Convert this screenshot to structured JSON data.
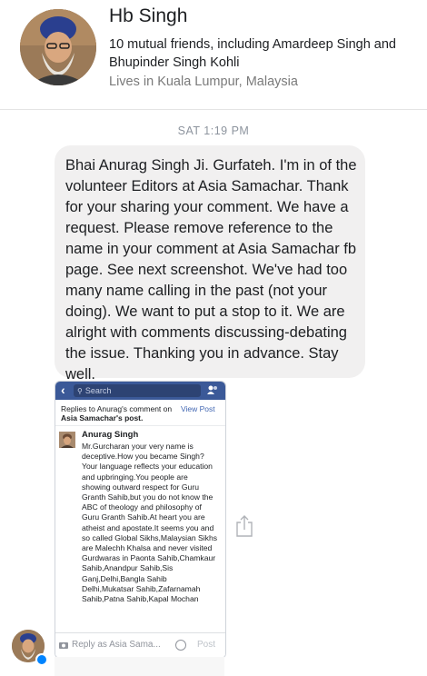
{
  "profile": {
    "name": "Hb Singh",
    "mutual_friends": "10 mutual friends, including Amardeep Singh and Bhupinder Singh Kohli",
    "lives_in": "Lives in Kuala Lumpur, Malaysia"
  },
  "timestamp": "SAT 1:19 PM",
  "message": {
    "text": "Bhai Anurag Singh Ji. Gurfateh. I'm in of the volunteer Editors at Asia Samachar. Thank for your sharing your comment. We have a request. Please remove reference to the name in your comment at Asia Samachar fb page. See next screenshot. We've had too many name calling in the past (not your doing). We want to put a stop to it. We are alright with comments discussing-debating the issue. Thanking you in advance. Stay well."
  },
  "screenshot": {
    "search_placeholder": "Search",
    "replies_prefix": "Replies to Anurag's comment on",
    "replies_page": "Asia Samachar's post.",
    "view_post": "View Post",
    "commenter": "Anurag Singh",
    "comment": "Mr.Gurcharan your very name is deceptive.How you became Singh? Your language reflects your education and upbringing.You people are showing outward respect for Guru Granth Sahib,but you do not know the ABC of theology and philosophy of Guru Granth Sahib.At heart you are atheist and apostate.It seems you and so called Global Sikhs,Malaysian Sikhs are Malechh Khalsa and never visited Gurdwaras in Paonta Sahib,Chamkaur Sahib,Anandpur Sahib,Sis Ganj,Delhi,Bangla Sahib Delhi,Mukatsar Sahib,Zafarnamah Sahib,Patna Sahib,Kapal Mochan",
    "reply_placeholder": "Reply as Asia Sama...",
    "post_label": "Post"
  },
  "colors": {
    "facebook_blue": "#3b5998",
    "link_blue": "#4267b2",
    "messenger_blue": "#0084ff",
    "bubble_gray": "#f1f0f0"
  }
}
